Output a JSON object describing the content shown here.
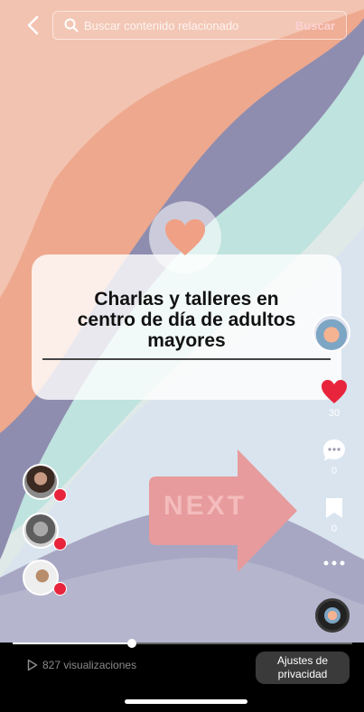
{
  "search": {
    "placeholder": "Buscar contenido relacionado",
    "button_label": "Buscar"
  },
  "video": {
    "title_lines": [
      "Charlas y talleres en",
      "centro de día de adultos",
      "mayores"
    ],
    "next_label": "NEXT"
  },
  "sidebar": {
    "likes_count": "30",
    "comments_count": "0",
    "saves_count": "0"
  },
  "footer": {
    "views_text": "827 visualizaciones",
    "privacy_line1": "Ajustes de",
    "privacy_line2": "privacidad"
  },
  "progress": 0.35,
  "colors": {
    "like_red": "#e8243c",
    "peach": "#eea98f",
    "lavender": "#8e8dad",
    "mint": "#d4ece9"
  },
  "icons": [
    "back-arrow-icon",
    "search-icon",
    "heart-icon",
    "comment-icon",
    "bookmark-icon",
    "more-icon",
    "play-icon"
  ]
}
